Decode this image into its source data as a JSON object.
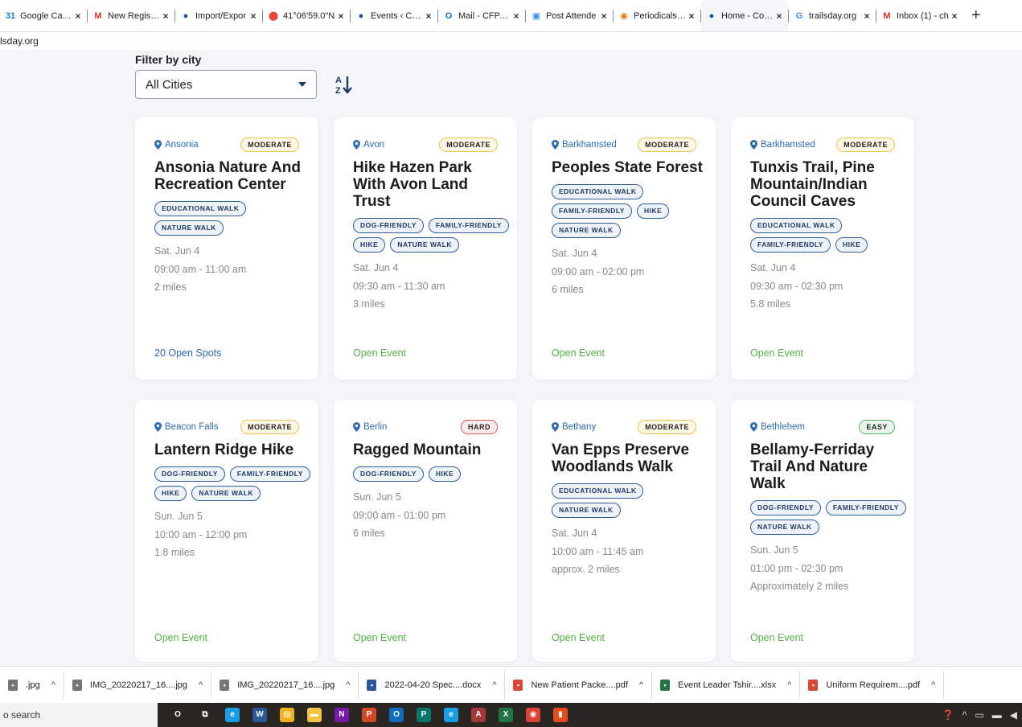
{
  "browser": {
    "tabs": [
      {
        "title": "Google Calen",
        "icon": "calendar-icon",
        "color": "#1a73e8",
        "glyph": "31"
      },
      {
        "title": "New Registrat",
        "icon": "gmail-icon",
        "color": "#d93025",
        "glyph": "M"
      },
      {
        "title": "Import/Expor",
        "icon": "site-icon",
        "color": "#1f4fa0",
        "glyph": "●"
      },
      {
        "title": "41°06'59.0\"N",
        "icon": "maps-icon",
        "color": "#e8453c",
        "glyph": "⬤"
      },
      {
        "title": "Events ‹ Conn",
        "icon": "site-icon",
        "color": "#1f4fa0",
        "glyph": "●"
      },
      {
        "title": "Mail - CFPA T",
        "icon": "outlook-icon",
        "color": "#0f6cbd",
        "glyph": "O"
      },
      {
        "title": "Post Attende",
        "icon": "zoom-icon",
        "color": "#2d8cff",
        "glyph": "▣"
      },
      {
        "title": "Periodicals in",
        "icon": "site-icon",
        "color": "#e8710a",
        "glyph": "◉"
      },
      {
        "title": "Home - Conn",
        "icon": "site-icon",
        "color": "#1f4fa0",
        "glyph": "●",
        "active": true
      },
      {
        "title": "trailsday.org",
        "icon": "google-icon",
        "color": "#4285f4",
        "glyph": "G"
      },
      {
        "title": "Inbox (1) - ch",
        "icon": "gmail-icon",
        "color": "#d93025",
        "glyph": "M"
      }
    ],
    "url": "lsday.org"
  },
  "filter": {
    "label": "Filter by city",
    "selected": "All Cities"
  },
  "events": [
    {
      "city": "Ansonia",
      "difficulty": "MODERATE",
      "level": "moderate",
      "title": "Ansonia Nature And Recreation Center",
      "tags": [
        "EDUCATIONAL WALK",
        "NATURE WALK"
      ],
      "date": "Sat. Jun 4",
      "time": "09:00 am - 11:00 am",
      "distance": "2 miles",
      "status": "20 Open Spots",
      "status_type": "spots"
    },
    {
      "city": "Avon",
      "difficulty": "MODERATE",
      "level": "moderate",
      "title": "Hike Hazen Park With Avon Land Trust",
      "tags": [
        "DOG-FRIENDLY",
        "FAMILY-FRIENDLY",
        "HIKE",
        "NATURE WALK"
      ],
      "date": "Sat. Jun 4",
      "time": "09:30 am - 11:30 am",
      "distance": "3 miles",
      "status": "Open Event",
      "status_type": "open"
    },
    {
      "city": "Barkhamsted",
      "difficulty": "MODERATE",
      "level": "moderate",
      "title": "Peoples State Forest",
      "tags": [
        "EDUCATIONAL WALK",
        "FAMILY-FRIENDLY",
        "HIKE",
        "NATURE WALK"
      ],
      "date": "Sat. Jun 4",
      "time": "09:00 am - 02:00 pm",
      "distance": "6 miles",
      "status": "Open Event",
      "status_type": "open"
    },
    {
      "city": "Barkhamsted",
      "difficulty": "MODERATE",
      "level": "moderate",
      "title": "Tunxis Trail, Pine Mountain/Indian Council Caves",
      "tags": [
        "EDUCATIONAL WALK",
        "FAMILY-FRIENDLY",
        "HIKE"
      ],
      "date": "Sat. Jun 4",
      "time": "09:30 am - 02:30 pm",
      "distance": "5.8 miles",
      "status": "Open Event",
      "status_type": "open"
    },
    {
      "city": "Beacon Falls",
      "difficulty": "MODERATE",
      "level": "moderate",
      "title": "Lantern Ridge Hike",
      "tags": [
        "DOG-FRIENDLY",
        "FAMILY-FRIENDLY",
        "HIKE",
        "NATURE WALK"
      ],
      "date": "Sun. Jun 5",
      "time": "10:00 am - 12:00 pm",
      "distance": "1.8 miles",
      "status": "Open Event",
      "status_type": "open"
    },
    {
      "city": "Berlin",
      "difficulty": "HARD",
      "level": "hard",
      "title": "Ragged Mountain",
      "tags": [
        "DOG-FRIENDLY",
        "HIKE"
      ],
      "date": "Sun. Jun 5",
      "time": "09:00 am - 01:00 pm",
      "distance": "6 miles",
      "status": "Open Event",
      "status_type": "open"
    },
    {
      "city": "Bethany",
      "difficulty": "MODERATE",
      "level": "moderate",
      "title": "Van Epps Preserve Woodlands Walk",
      "tags": [
        "EDUCATIONAL WALK",
        "NATURE WALK"
      ],
      "date": "Sat. Jun 4",
      "time": "10:00 am - 11:45 am",
      "distance": "approx. 2 miles",
      "status": "Open Event",
      "status_type": "open"
    },
    {
      "city": "Bethlehem",
      "difficulty": "EASY",
      "level": "easy",
      "title": "Bellamy-Ferriday Trail And Nature Walk",
      "tags": [
        "DOG-FRIENDLY",
        "FAMILY-FRIENDLY",
        "NATURE WALK"
      ],
      "date": "Sun. Jun 5",
      "time": "01:00 pm - 02:30 pm",
      "distance": "Approximately 2 miles",
      "status": "Open Event",
      "status_type": "open"
    }
  ],
  "downloads": [
    {
      "name": ".jpg",
      "icon": "image-file-icon",
      "color": "#777"
    },
    {
      "name": "IMG_20220217_16....jpg",
      "icon": "image-file-icon",
      "color": "#777"
    },
    {
      "name": "IMG_20220217_16....jpg",
      "icon": "image-file-icon",
      "color": "#777"
    },
    {
      "name": "2022-04-20 Spec....docx",
      "icon": "word-file-icon",
      "color": "#2b579a"
    },
    {
      "name": "New Patient Packe....pdf",
      "icon": "chrome-pdf-icon",
      "color": "#db4437"
    },
    {
      "name": "Event Leader Tshir....xlsx",
      "icon": "excel-file-icon",
      "color": "#217346"
    },
    {
      "name": "Uniform Requirem....pdf",
      "icon": "chrome-pdf-icon",
      "color": "#db4437"
    }
  ],
  "taskbar": {
    "search_text": "o search",
    "apps": [
      {
        "icon": "cortana-icon",
        "color": "#2a2722",
        "glyph": "O"
      },
      {
        "icon": "task-view-icon",
        "color": "#2a2722",
        "glyph": "⧉"
      },
      {
        "icon": "edge-icon",
        "color": "#1b9de2",
        "glyph": "e"
      },
      {
        "icon": "word-icon",
        "color": "#2b579a",
        "glyph": "W"
      },
      {
        "icon": "store-icon",
        "color": "#f2b01e",
        "glyph": "▤"
      },
      {
        "icon": "file-explorer-icon",
        "color": "#f4c542",
        "glyph": "▬"
      },
      {
        "icon": "onenote-icon",
        "color": "#7719aa",
        "glyph": "N"
      },
      {
        "icon": "powerpoint-icon",
        "color": "#d24726",
        "glyph": "P"
      },
      {
        "icon": "outlook-icon",
        "color": "#0f6cbd",
        "glyph": "O"
      },
      {
        "icon": "publisher-icon",
        "color": "#077568",
        "glyph": "P"
      },
      {
        "icon": "ie-icon",
        "color": "#1b9de2",
        "glyph": "e"
      },
      {
        "icon": "access-icon",
        "color": "#a4373a",
        "glyph": "A"
      },
      {
        "icon": "excel-icon",
        "color": "#217346",
        "glyph": "X"
      },
      {
        "icon": "chrome-icon",
        "color": "#db4437",
        "glyph": "◉"
      },
      {
        "icon": "office-icon",
        "color": "#e74c1c",
        "glyph": "▮"
      }
    ]
  }
}
